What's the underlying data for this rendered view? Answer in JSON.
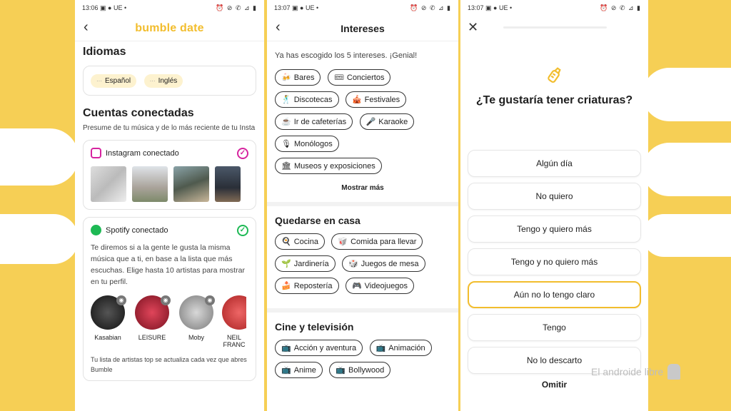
{
  "colors": {
    "accent": "#f2bd2d",
    "background": "#f6cf55",
    "instagram": "#d6249f",
    "spotify": "#1db954"
  },
  "screen1": {
    "status_time": "13:06",
    "status_left": "▣ ● UE •",
    "status_right": "⏰ ⊘ ✆ ⊿ ▮",
    "back_icon": "‹",
    "logo": "bumble date",
    "languages_title": "Idiomas",
    "languages": [
      "Español",
      "Inglés"
    ],
    "connected_title": "Cuentas conectadas",
    "connected_desc": "Presume de tu música y de lo más reciente de tu Insta",
    "instagram_label": "Instagram conectado",
    "spotify_label": "Spotify conectado",
    "spotify_desc": "Te diremos si a la gente le gusta la misma música que a ti, en base a la lista que más escuchas. Elige hasta 10 artistas para mostrar en tu perfil.",
    "artists": [
      "Kasabian",
      "LEISURE",
      "Moby",
      "NEIL FRANC"
    ],
    "footer_note": "Tu lista de artistas top se actualiza cada vez que abres Bumble"
  },
  "screen2": {
    "status_time": "13:07",
    "title": "Intereses",
    "chosen_note": "Ya has escogido los 5 intereses. ¡Genial!",
    "interests": [
      {
        "icon": "🍻",
        "label": "Bares"
      },
      {
        "icon": "🎟",
        "label": "Conciertos"
      },
      {
        "icon": "🕺",
        "label": "Discotecas"
      },
      {
        "icon": "🎪",
        "label": "Festivales"
      },
      {
        "icon": "☕",
        "label": "Ir de cafeterías"
      },
      {
        "icon": "🎤",
        "label": "Karaoke"
      },
      {
        "icon": "🎙",
        "label": "Monólogos"
      },
      {
        "icon": "🏛",
        "label": "Museos y exposiciones"
      }
    ],
    "show_more": "Mostrar más",
    "home_title": "Quedarse en casa",
    "home": [
      {
        "icon": "🍳",
        "label": "Cocina"
      },
      {
        "icon": "🥡",
        "label": "Comida para llevar"
      },
      {
        "icon": "🌱",
        "label": "Jardinería"
      },
      {
        "icon": "🎲",
        "label": "Juegos de mesa"
      },
      {
        "icon": "🍰",
        "label": "Repostería"
      },
      {
        "icon": "🎮",
        "label": "Videojuegos"
      }
    ],
    "tv_title": "Cine y televisión",
    "tv": [
      {
        "icon": "📺",
        "label": "Acción y aventura"
      },
      {
        "icon": "📺",
        "label": "Animación"
      },
      {
        "icon": "📺",
        "label": "Anime"
      },
      {
        "icon": "📺",
        "label": "Bollywood"
      }
    ]
  },
  "screen3": {
    "status_time": "13:07",
    "close_icon": "✕",
    "question": "¿Te gustaría tener criaturas?",
    "options": [
      "Algún día",
      "No quiero",
      "Tengo y quiero más",
      "Tengo y no quiero más",
      "Aún no lo tengo claro",
      "Tengo",
      "No lo descarto"
    ],
    "selected_index": 4,
    "skip": "Omitir"
  },
  "watermark": "El androide libre"
}
